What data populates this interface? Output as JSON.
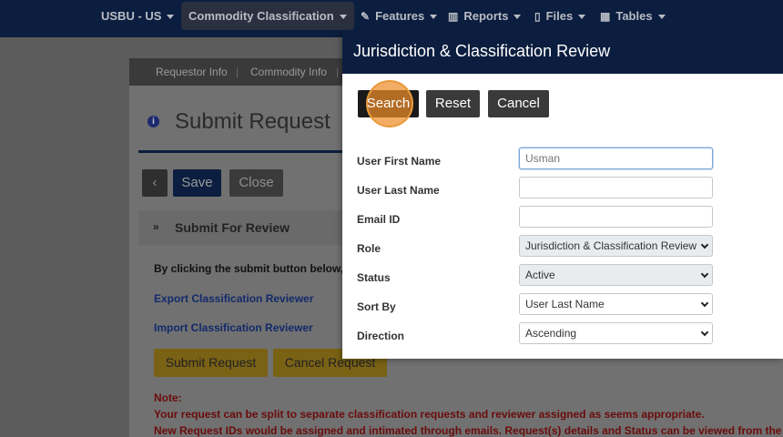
{
  "nav": {
    "items": [
      {
        "label": "USBU - US"
      },
      {
        "label": "Commodity Classification"
      },
      {
        "label": "Features"
      },
      {
        "label": "Reports"
      },
      {
        "label": "Files"
      },
      {
        "label": "Tables"
      }
    ]
  },
  "background": {
    "tabs": [
      "Requestor Info",
      "Commodity Info"
    ],
    "title": "Submit Request",
    "save_label": "Save",
    "close_label": "Close",
    "section_title": "Submit For Review",
    "instruction": "By clicking the submit button below,",
    "link_export": "Export Classification Reviewer",
    "link_import": "Import Classification Reviewer",
    "submit_label": "Submit Request",
    "cancel_request_label": "Cancel Request",
    "note_label": "Note:",
    "note_line1": "Your request can be split to separate classification requests and reviewer assigned as seems appropriate.",
    "note_line2": "New Request IDs would be assigned and intimated through emails. Request(s) details and Status can be viewed from the"
  },
  "modal": {
    "title": "Jurisdiction & Classification Review",
    "search_label": "Search",
    "reset_label": "Reset",
    "cancel_label": "Cancel",
    "fields": {
      "first_name": {
        "label": "User First Name",
        "placeholder": "Usman"
      },
      "last_name": {
        "label": "User Last Name",
        "value": ""
      },
      "email": {
        "label": "Email ID",
        "value": ""
      },
      "role": {
        "label": "Role",
        "value": "Jurisdiction & Classification Review"
      },
      "status": {
        "label": "Status",
        "value": "Active"
      },
      "sort_by": {
        "label": "Sort By",
        "value": "User Last Name"
      },
      "direction": {
        "label": "Direction",
        "value": "Ascending"
      }
    }
  }
}
